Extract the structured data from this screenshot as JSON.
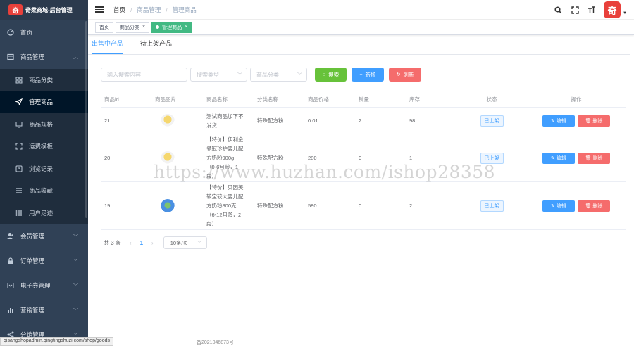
{
  "brand": {
    "logo_char": "奇",
    "title": "奇柔商城-后台管理"
  },
  "sidebar": {
    "items": [
      {
        "label": "首页",
        "icon": "dashboard-icon"
      },
      {
        "label": "商品管理",
        "icon": "product-icon",
        "expanded": true
      },
      {
        "label": "会员管理",
        "icon": "user-icon"
      },
      {
        "label": "订单管理",
        "icon": "lock-icon"
      },
      {
        "label": "电子券管理",
        "icon": "coupon-icon"
      },
      {
        "label": "营销管理",
        "icon": "chart-icon"
      },
      {
        "label": "分销管理",
        "icon": "share-icon"
      }
    ],
    "sub_items": [
      {
        "label": "商品分类"
      },
      {
        "label": "管理商品",
        "active": true
      },
      {
        "label": "商品规格"
      },
      {
        "label": "运费模板"
      },
      {
        "label": "浏览记录"
      },
      {
        "label": "商品收藏"
      },
      {
        "label": "用户足迹"
      }
    ]
  },
  "header": {
    "breadcrumb": [
      "首页",
      "商品管理",
      "管理商品"
    ],
    "avatar_char": "奇",
    "icons": [
      "search-icon",
      "fullscreen-icon",
      "font-size-icon"
    ]
  },
  "tags": [
    {
      "label": "首页"
    },
    {
      "label": "商品分类",
      "closable": true
    },
    {
      "label": "管理商品",
      "closable": true,
      "active": true
    }
  ],
  "tabs": [
    "出售中产品",
    "待上架产品"
  ],
  "filters": {
    "search_placeholder": "输入搜索内容",
    "type_placeholder": "搜索类型",
    "category_placeholder": "商品分类",
    "search_btn": "搜索",
    "add_btn": "新增",
    "refresh_btn": "刷新"
  },
  "table": {
    "headers": [
      "商品id",
      "商品图片",
      "商品名称",
      "分类名称",
      "商品价格",
      "销量",
      "库存",
      "状态",
      "操作"
    ],
    "rows": [
      {
        "id": "21",
        "name": "测试商品加下不发货",
        "category": "特殊配方粉",
        "price": "0.01",
        "sales": "2",
        "stock": "98",
        "status": "已上架"
      },
      {
        "id": "20",
        "name": "【特价】伊利金领冠珍护婴儿配方奶粉900g（0-6月龄，1段）",
        "category": "特殊配方粉",
        "price": "280",
        "sales": "0",
        "stock": "1",
        "status": "已上架"
      },
      {
        "id": "19",
        "name": "【特价】贝因美较宝较大婴儿配方奶粉800克（6-12月龄，2段）",
        "category": "特殊配方粉",
        "price": "580",
        "sales": "0",
        "stock": "2",
        "status": "已上架"
      }
    ],
    "edit_label": "编辑",
    "delete_label": "删除"
  },
  "pagination": {
    "total": "共 3 条",
    "current": "1",
    "page_size": "10条/页"
  },
  "watermark": "https://www.huzhan.com/ishop28358",
  "footer": {
    "icp": "备2021046873号"
  },
  "statusbar": {
    "url": "qisangshopadmin.qingtingshuzi.com/shop/goods"
  },
  "colors": {
    "sidebar": "#304156",
    "primary": "#409eff",
    "success": "#67c23a",
    "danger": "#f56c6c",
    "tag_active": "#42b983",
    "brand": "#e8403b"
  }
}
